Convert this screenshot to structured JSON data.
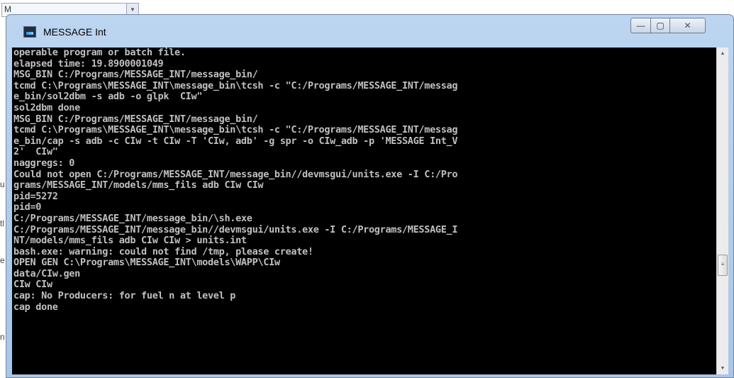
{
  "window": {
    "title": "MESSAGE Int",
    "controls": {
      "minimize": "—",
      "maximize": "▢",
      "close": "✕"
    }
  },
  "background": {
    "combo_text": "M",
    "letters": [
      "u",
      "tl",
      "e",
      "n"
    ]
  },
  "console": {
    "lines": [
      "operable program or batch file.",
      "elapsed time: 19.8900001049",
      "MSG_BIN C:/Programs/MESSAGE_INT/message_bin/",
      "tcmd C:\\Programs\\MESSAGE_INT\\message_bin\\tcsh -c \"C:/Programs/MESSAGE_INT/messag",
      "e_bin/sol2dbm -s adb -o glpk  CIw\"",
      "sol2dbm done",
      "MSG_BIN C:/Programs/MESSAGE_INT/message_bin/",
      "tcmd C:\\Programs\\MESSAGE_INT\\message_bin\\tcsh -c \"C:/Programs/MESSAGE_INT/messag",
      "e_bin/cap -s adb -c CIw -t CIw -T 'CIw, adb' -g spr -o CIw_adb -p 'MESSAGE Int_V",
      "2'  CIw\"",
      "naggregs: 0",
      "Could not open C:/Programs/MESSAGE_INT/message_bin//devmsgui/units.exe -I C:/Pro",
      "grams/MESSAGE_INT/models/mms_fils adb CIw CIw",
      "pid=5272",
      "pid=0",
      "C:/Programs/MESSAGE_INT/message_bin/\\sh.exe",
      "C:/Programs/MESSAGE_INT/message_bin//devmsgui/units.exe -I C:/Programs/MESSAGE_I",
      "NT/models/mms_fils adb CIw CIw > units.int",
      "bash.exe: warning: could not find /tmp, please create!",
      "OPEN GEN C:\\Programs\\MESSAGE_INT\\models\\WAPP\\CIw",
      "data/CIw.gen",
      "CIw CIw",
      "cap: No Producers: for fuel n at level p",
      "cap done"
    ]
  },
  "scrollbar": {
    "up": "▲",
    "down": "▼",
    "thumb_grip": "≡"
  },
  "colors": {
    "console_bg": "#000000",
    "console_text": "#c0c0c0",
    "titlebar": "#b4cfee"
  }
}
